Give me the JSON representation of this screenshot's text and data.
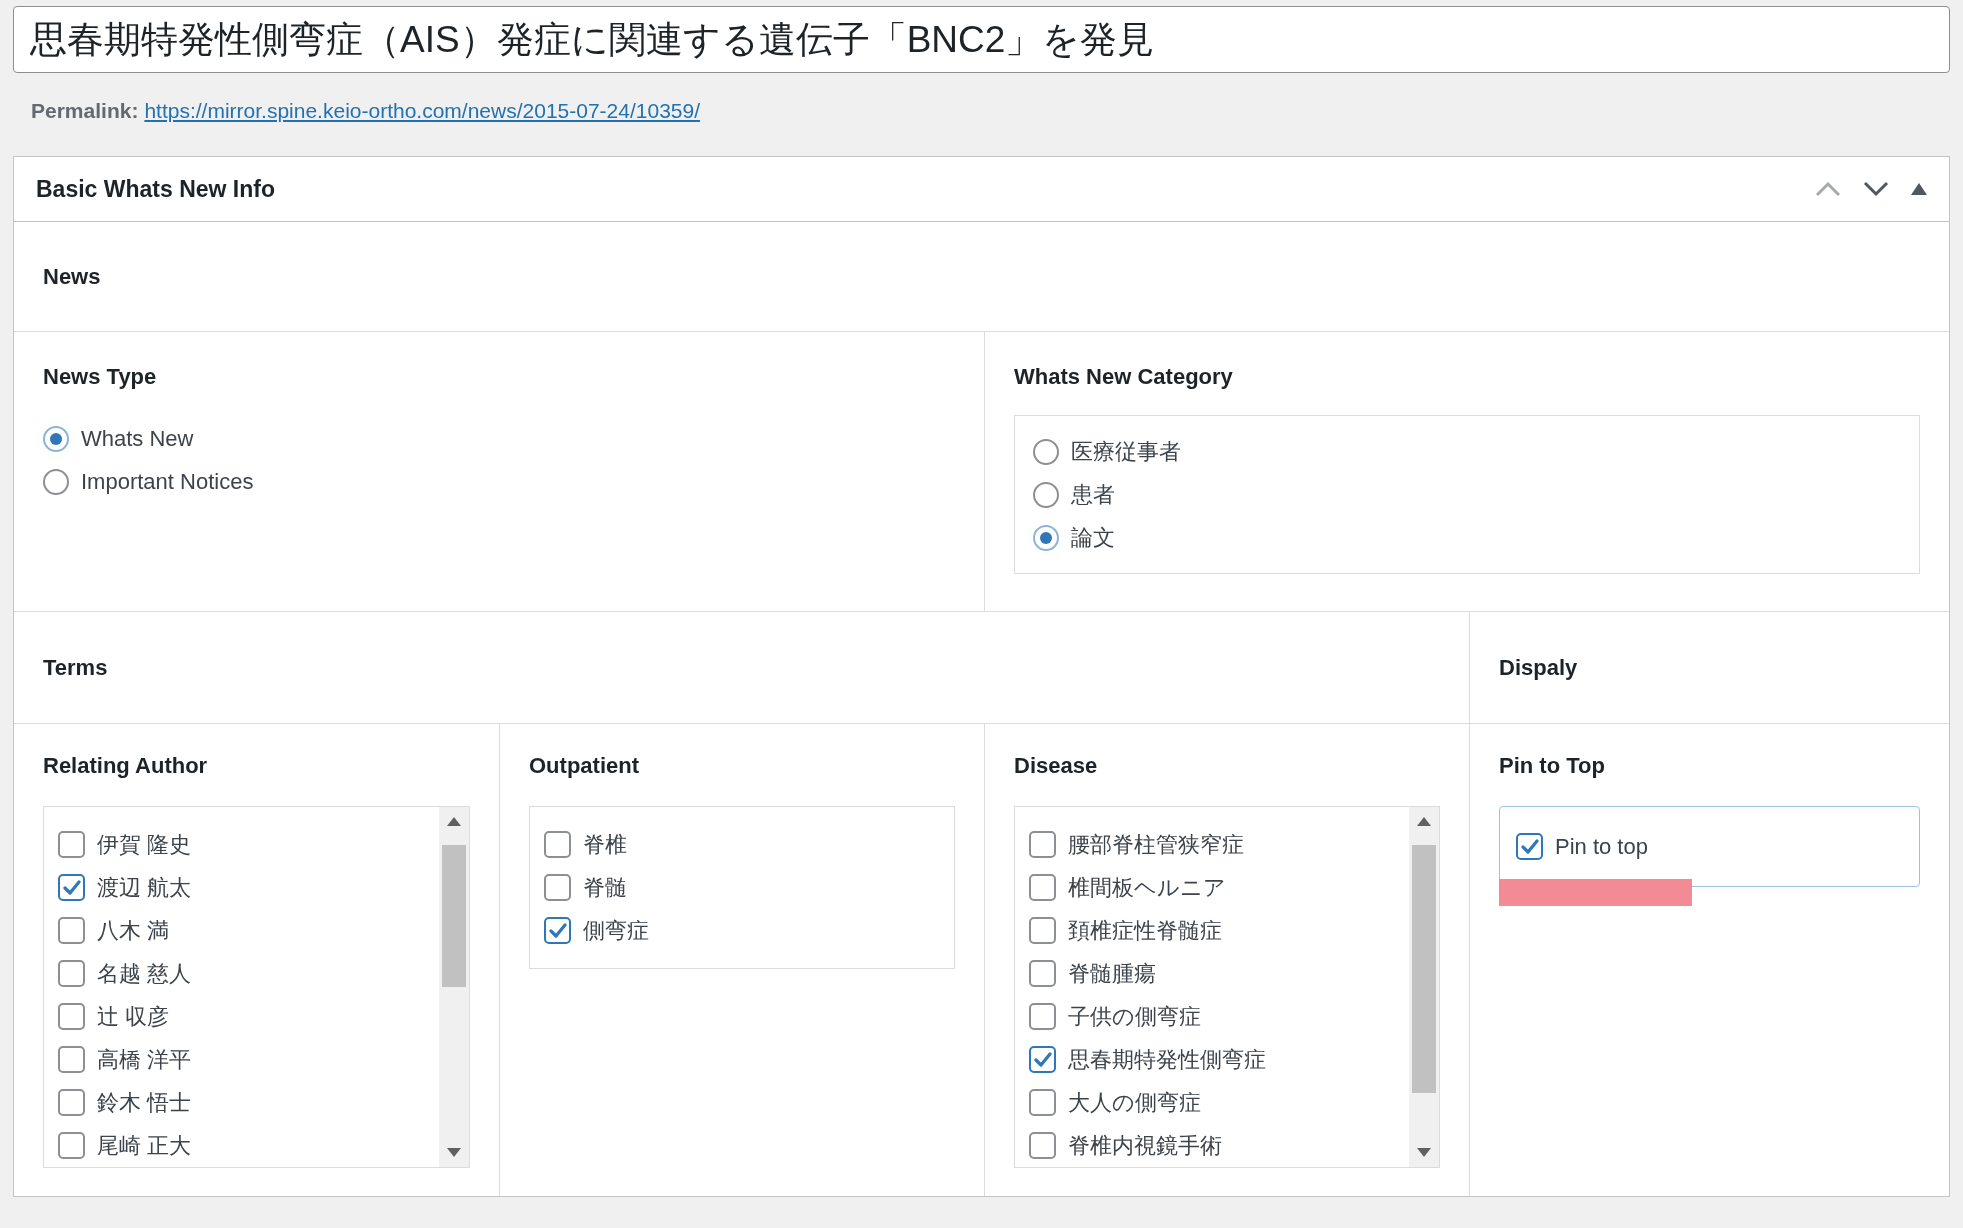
{
  "title_field": {
    "value": "思春期特発性側弯症（AIS）発症に関連する遺伝子「BNC2」を発見"
  },
  "permalink": {
    "label": "Permalink:",
    "url": "https://mirror.spine.keio-ortho.com/news/2015-07-24/10359/"
  },
  "panel": {
    "title": "Basic Whats New Info"
  },
  "news_section": {
    "heading": "News"
  },
  "news_type": {
    "label": "News Type",
    "options": [
      {
        "label": "Whats New",
        "selected": true
      },
      {
        "label": "Important Notices",
        "selected": false
      }
    ]
  },
  "category": {
    "label": "Whats New Category",
    "options": [
      {
        "label": "医療従事者",
        "selected": false
      },
      {
        "label": "患者",
        "selected": false
      },
      {
        "label": "論文",
        "selected": true
      }
    ]
  },
  "terms": {
    "heading": "Terms"
  },
  "display": {
    "heading": "Dispaly"
  },
  "relating_author": {
    "label": "Relating Author",
    "items": [
      {
        "label": "伊賀 隆史",
        "checked": false
      },
      {
        "label": "渡辺 航太",
        "checked": true
      },
      {
        "label": "八木 満",
        "checked": false
      },
      {
        "label": "名越 慈人",
        "checked": false
      },
      {
        "label": "辻 収彦",
        "checked": false
      },
      {
        "label": "高橋 洋平",
        "checked": false
      },
      {
        "label": "鈴木 悟士",
        "checked": false
      },
      {
        "label": "尾崎 正大",
        "checked": false
      }
    ]
  },
  "outpatient": {
    "label": "Outpatient",
    "items": [
      {
        "label": "脊椎",
        "checked": false
      },
      {
        "label": "脊髄",
        "checked": false
      },
      {
        "label": "側弯症",
        "checked": true
      }
    ]
  },
  "disease": {
    "label": "Disease",
    "items": [
      {
        "label": "腰部脊柱管狭窄症",
        "checked": false
      },
      {
        "label": "椎間板ヘルニア",
        "checked": false
      },
      {
        "label": "頚椎症性脊髄症",
        "checked": false
      },
      {
        "label": "脊髄腫瘍",
        "checked": false
      },
      {
        "label": "子供の側弯症",
        "checked": false
      },
      {
        "label": "思春期特発性側弯症",
        "checked": true
      },
      {
        "label": "大人の側弯症",
        "checked": false
      },
      {
        "label": "脊椎内視鏡手術",
        "checked": false
      }
    ]
  },
  "pin_to_top": {
    "label": "Pin to Top",
    "items": [
      {
        "label": "Pin to top",
        "checked": true
      }
    ]
  }
}
